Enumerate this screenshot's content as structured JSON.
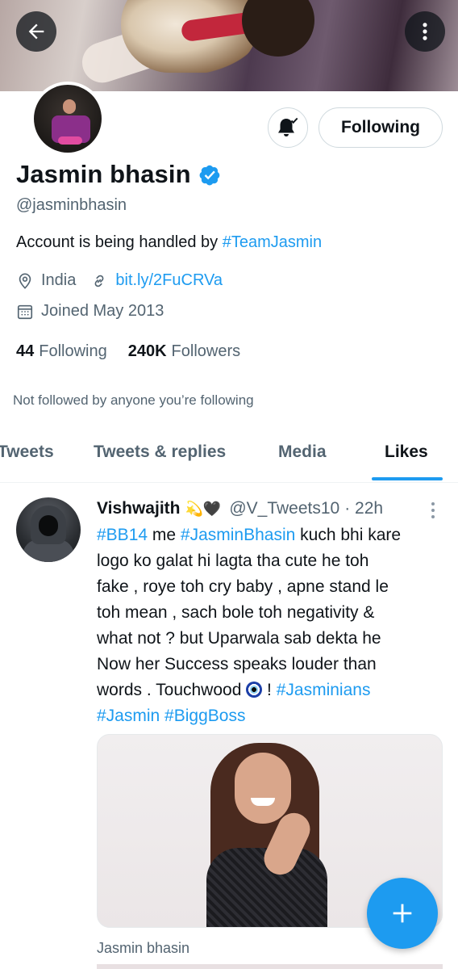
{
  "profile": {
    "name": "Jasmin bhasin",
    "handle": "@jasminbhasin",
    "bio_text": "Account is being handled by ",
    "bio_hashtag": "#TeamJasmin",
    "location": "India",
    "website": "bit.ly/2FuCRVa",
    "joined": "Joined May 2013",
    "following_count": "44",
    "following_label": "Following",
    "followers_count": "240K",
    "followers_label": "Followers",
    "not_followed_text": "Not followed by anyone you’re following",
    "verified": true
  },
  "actions": {
    "follow_button_label": "Following",
    "bell_icon": "bell-check-icon",
    "back_icon": "arrow-left-icon",
    "more_icon": "more-vertical-icon"
  },
  "tabs": [
    {
      "label": "Tweets",
      "active": false
    },
    {
      "label": "Tweets & replies",
      "active": false
    },
    {
      "label": "Media",
      "active": false
    },
    {
      "label": "Likes",
      "active": true
    }
  ],
  "tweet": {
    "author_name": "Vishwajith",
    "author_emoji": "💫🖤",
    "author_handle": "@V_Tweets10",
    "time": "· 22h",
    "lines": {
      "l1_tag1": "#BB14",
      "l1_mid": " me ",
      "l1_tag2": "#JasminBhasin",
      "l1_end": " kuch bhi kare",
      "l2": "logo ko galat hi lagta tha cute he toh",
      "l3": "fake , roye toh cry baby , apne stand le",
      "l4": "toh mean , sach bole toh negativity &",
      "l5": "what not ? but Uparwala sab dekta he",
      "l6": "Now her Success speaks louder than",
      "l7_start": "words . Touchwood ",
      "l7_mid": " ! ",
      "l7_tag": "#Jasminians",
      "l8_tag1": "#Jasmin",
      "l8_space": " ",
      "l8_tag2": "#BiggBoss"
    },
    "media_caption": "Jasmin bhasin"
  },
  "colors": {
    "accent": "#1d9bf0",
    "text_primary": "#0f1419",
    "text_secondary": "#536471",
    "border": "#cfd9de"
  },
  "fab_icon": "plus-icon"
}
